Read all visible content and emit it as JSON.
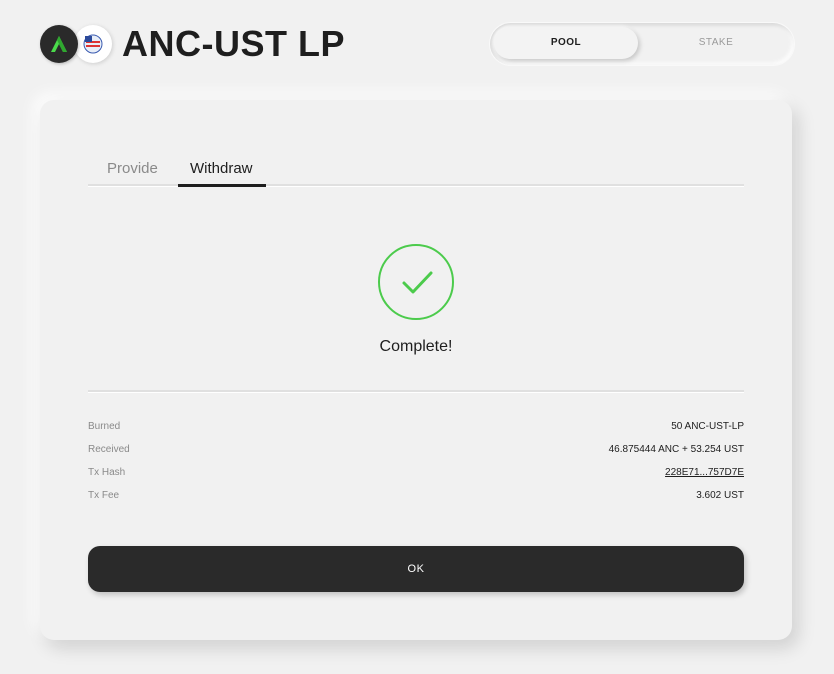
{
  "header": {
    "title": "ANC-UST LP",
    "token_icons": [
      "anchor-logo-icon",
      "ust-logo-icon"
    ]
  },
  "segment": {
    "pool_label": "POOL",
    "stake_label": "STAKE",
    "selected": "POOL"
  },
  "tabs": [
    {
      "label": "Provide",
      "active": false
    },
    {
      "label": "Withdraw",
      "active": true
    }
  ],
  "result": {
    "status": "Complete!",
    "icon": "check-icon"
  },
  "details": [
    {
      "label": "Burned",
      "value": "50 ANC-UST-LP"
    },
    {
      "label": "Received",
      "value": "46.875444 ANC + 53.254 UST"
    },
    {
      "label": "Tx Hash",
      "value": "228E71...757D7E"
    },
    {
      "label": "Tx Fee",
      "value": "3.602 UST"
    }
  ],
  "ok_label": "OK",
  "colors": {
    "success": "#4ccb4c",
    "primary_button": "#2a2a2a",
    "background": "#f1f1f1"
  }
}
